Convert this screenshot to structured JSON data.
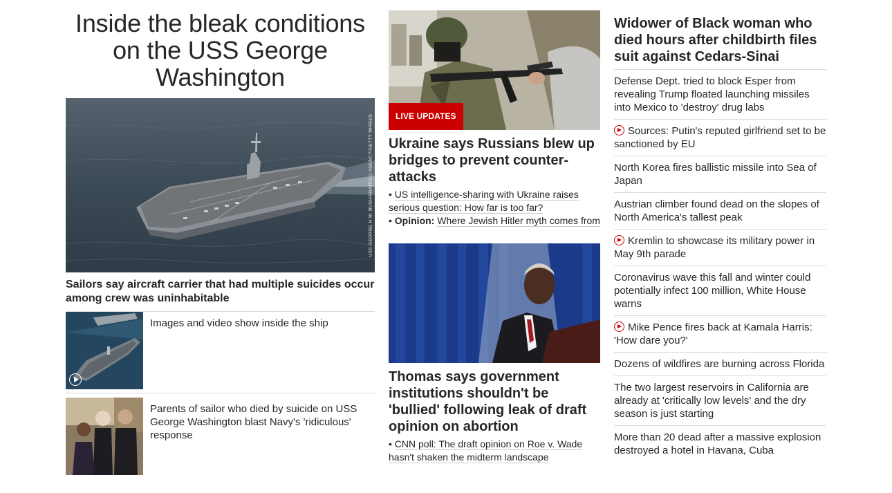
{
  "lead": {
    "headline": "Inside the bleak conditions on the USS George Washington",
    "image_credit": "USS GEORGE H.W. BUSH/ANADOLU AGENCY/GETTY IMAGES",
    "caption": "Sailors say aircraft carrier that had multiple suicides occur among crew was uninhabitable",
    "stories": [
      {
        "text": "Images and video show inside the ship",
        "has_video": true
      },
      {
        "text": "Parents of sailor who died by suicide on USS George Washington blast Navy's 'ridiculous' response",
        "has_video": false
      }
    ]
  },
  "middle": {
    "block1": {
      "badge": "LIVE UPDATES",
      "headline": "Ukraine says Russians blew up bridges to prevent counter-attacks",
      "bullets": [
        {
          "prefix": "",
          "text": "US intelligence-sharing with Ukraine raises serious question: How far is too far?"
        },
        {
          "prefix": "Opinion:",
          "text": "Where Jewish Hitler myth comes from"
        }
      ]
    },
    "block2": {
      "headline": "Thomas says government institutions shouldn't be 'bullied' following leak of draft opinion on abortion",
      "bullets": [
        {
          "prefix": "",
          "text": "CNN poll: The draft opinion on Roe v. Wade hasn't shaken the midterm landscape"
        }
      ]
    }
  },
  "right": {
    "headline": "Widower of Black woman who died hours after childbirth files suit against Cedars-Sinai",
    "items": [
      {
        "text": "Defense Dept. tried to block Esper from revealing Trump floated launching missiles into Mexico to 'destroy' drug labs",
        "video": false
      },
      {
        "text": "Sources: Putin's reputed girlfriend set to be sanctioned by EU",
        "video": true
      },
      {
        "text": "North Korea fires ballistic missile into Sea of Japan",
        "video": false
      },
      {
        "text": "Austrian climber found dead on the slopes of North America's tallest peak",
        "video": false
      },
      {
        "text": "Kremlin to showcase its military power in May 9th parade",
        "video": true
      },
      {
        "text": "Coronavirus wave this fall and winter could potentially infect 100 million, White House warns",
        "video": false
      },
      {
        "text": "Mike Pence fires back at Kamala Harris: 'How dare you?'",
        "video": true
      },
      {
        "text": "Dozens of wildfires are burning across Florida",
        "video": false
      },
      {
        "text": "The two largest reservoirs in California are already at 'critically low levels' and the dry season is just starting",
        "video": false
      },
      {
        "text": "More than 20 dead after a massive explosion destroyed a hotel in Havana, Cuba",
        "video": false
      }
    ]
  },
  "colors": {
    "accent": "#cc0000",
    "text": "#262626",
    "divider": "#dcdcdc"
  }
}
